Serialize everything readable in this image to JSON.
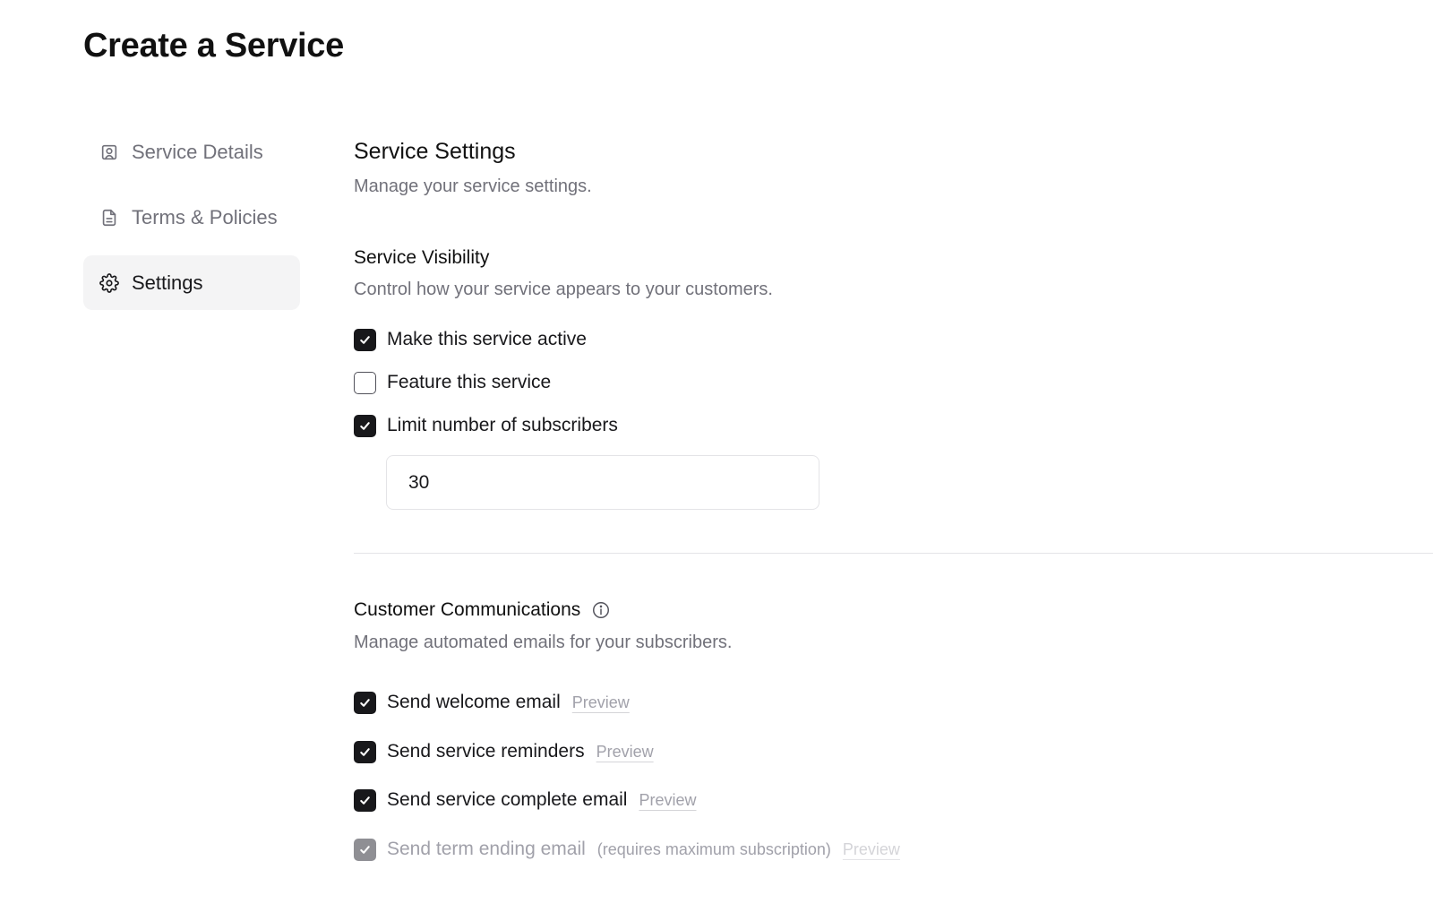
{
  "page": {
    "title": "Create a Service"
  },
  "sidebar": {
    "items": [
      {
        "label": "Service Details",
        "icon": "user-square-icon",
        "active": false
      },
      {
        "label": "Terms & Policies",
        "icon": "document-icon",
        "active": false
      },
      {
        "label": "Settings",
        "icon": "gear-icon",
        "active": true
      }
    ]
  },
  "settings": {
    "title": "Service Settings",
    "description": "Manage your service settings.",
    "visibility": {
      "title": "Service Visibility",
      "description": "Control how your service appears to your customers.",
      "options": [
        {
          "label": "Make this service active",
          "checked": true
        },
        {
          "label": "Feature this service",
          "checked": false
        },
        {
          "label": "Limit number of subscribers",
          "checked": true
        }
      ],
      "subscriber_limit": "30"
    },
    "communications": {
      "title": "Customer Communications",
      "description": "Manage automated emails for your subscribers.",
      "options": [
        {
          "label": "Send welcome email",
          "checked": true,
          "preview": "Preview"
        },
        {
          "label": "Send service reminders",
          "checked": true,
          "preview": "Preview"
        },
        {
          "label": "Send service complete email",
          "checked": true,
          "preview": "Preview"
        },
        {
          "label": "Send term ending email",
          "checked": true,
          "disabled": true,
          "note": "(requires maximum subscription)",
          "preview": "Preview"
        }
      ]
    }
  },
  "colors": {
    "text": "#18181b",
    "muted": "#71717a",
    "checkbox_checked": "#18181b",
    "active_bg": "#f4f4f5"
  }
}
